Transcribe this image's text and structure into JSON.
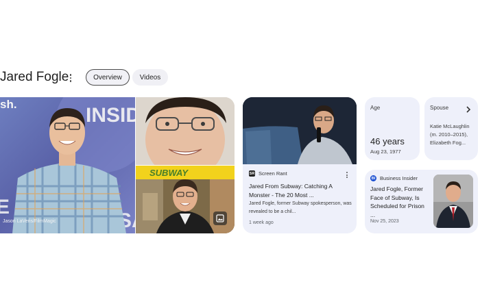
{
  "header": {
    "title": "Jared Fogle",
    "tabs": [
      {
        "label": "Overview",
        "active": true
      },
      {
        "label": "Videos",
        "active": false
      }
    ]
  },
  "images": {
    "main_credit": "Jason LaVeris/FilmMagic",
    "main_backdrop_text": "INSIDE OUT",
    "main_left_text": "sh.",
    "shop_sign_text": "SUBWAY",
    "icons": [
      "image-icon",
      "more-vert-icon"
    ]
  },
  "news_card": {
    "source": "Screen Rant",
    "source_badge": "SR",
    "headline": "Jared From Subway: Catching A Monster - The 20 Most ...",
    "snippet": "Jared Fogle, former Subway spokesperson, was revealed to be a chil...",
    "date": "1 week ago"
  },
  "facts": {
    "age": {
      "label": "Age",
      "value": "46 years",
      "detail": "Aug 23, 1977"
    },
    "spouse": {
      "label": "Spouse",
      "names": "Katie McLaughlin (m. 2010–2015), Elizabeth Fog..."
    }
  },
  "bi_card": {
    "source": "Business Insider",
    "source_badge": "BI",
    "headline": "Jared Fogle, Former Face of Subway, Is Scheduled for Prison ...",
    "date": "Nov 25, 2023"
  },
  "colors": {
    "card_bg": "#eef0fa",
    "chip_bg": "#f1f1f6",
    "text": "#1f1f1f",
    "muted": "#5f6368",
    "backdrop_blue": "#5a62a8",
    "bi_badge": "#1b4fd1",
    "sr_badge": "#222222"
  }
}
